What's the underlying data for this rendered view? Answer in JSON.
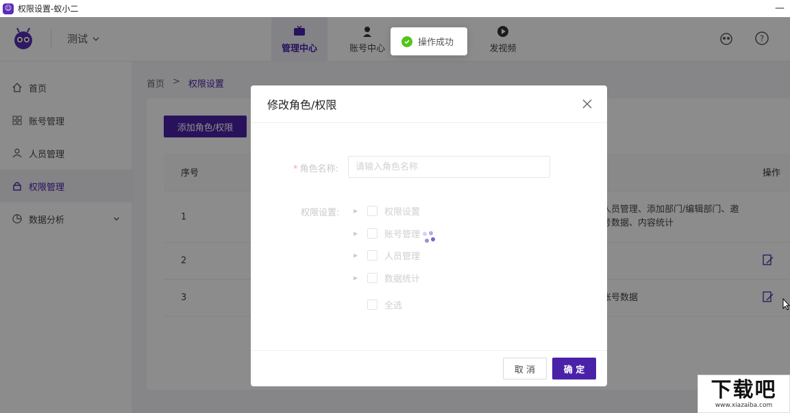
{
  "window": {
    "title": "权限设置-蚁小二"
  },
  "topnav": {
    "workspace": "测试",
    "tabs": [
      {
        "label": "管理中心",
        "icon": "tv-icon",
        "active": true
      },
      {
        "label": "账号中心",
        "icon": "user-icon",
        "active": false
      },
      {
        "label": "",
        "icon": "user-icon",
        "active": false
      },
      {
        "label": "发视频",
        "icon": "play-icon",
        "active": false
      }
    ]
  },
  "sidebar": {
    "items": [
      {
        "label": "首页",
        "icon": "home-icon"
      },
      {
        "label": "账号管理",
        "icon": "grid-icon"
      },
      {
        "label": "人员管理",
        "icon": "person-icon"
      },
      {
        "label": "权限管理",
        "icon": "lock-icon",
        "active": true
      },
      {
        "label": "数据分析",
        "icon": "pie-chart-icon",
        "expandable": true
      }
    ]
  },
  "breadcrumb": {
    "home": "首页",
    "separator": ">",
    "current": "权限设置"
  },
  "main": {
    "add_button": "添加角色/权限",
    "table": {
      "headers": {
        "index": "序号",
        "operation": "操作"
      },
      "rows": [
        {
          "index": "1",
          "permissions_line1": "人员管理、添加部门/编辑部门、邀",
          "permissions_line2": "号数据、内容统计"
        },
        {
          "index": "2",
          "permissions_line1": "",
          "permissions_line2": ""
        },
        {
          "index": "3",
          "permissions_line1": "账号数据",
          "permissions_line2": ""
        }
      ]
    }
  },
  "toast": {
    "message": "操作成功"
  },
  "modal": {
    "title": "修改角色/权限",
    "role_name_label": "角色名称:",
    "role_name_placeholder": "请输入角色名称",
    "permission_label": "权限设置:",
    "tree": [
      "权限设置",
      "账号管理",
      "人员管理",
      "数据统计"
    ],
    "select_all": "全选",
    "cancel": "取 消",
    "confirm": "确 定"
  },
  "watermark": {
    "main": "下载吧",
    "sub": "www.xiazaiba.com"
  },
  "colors": {
    "brand": "#4a22a8",
    "success": "#52c41a"
  }
}
